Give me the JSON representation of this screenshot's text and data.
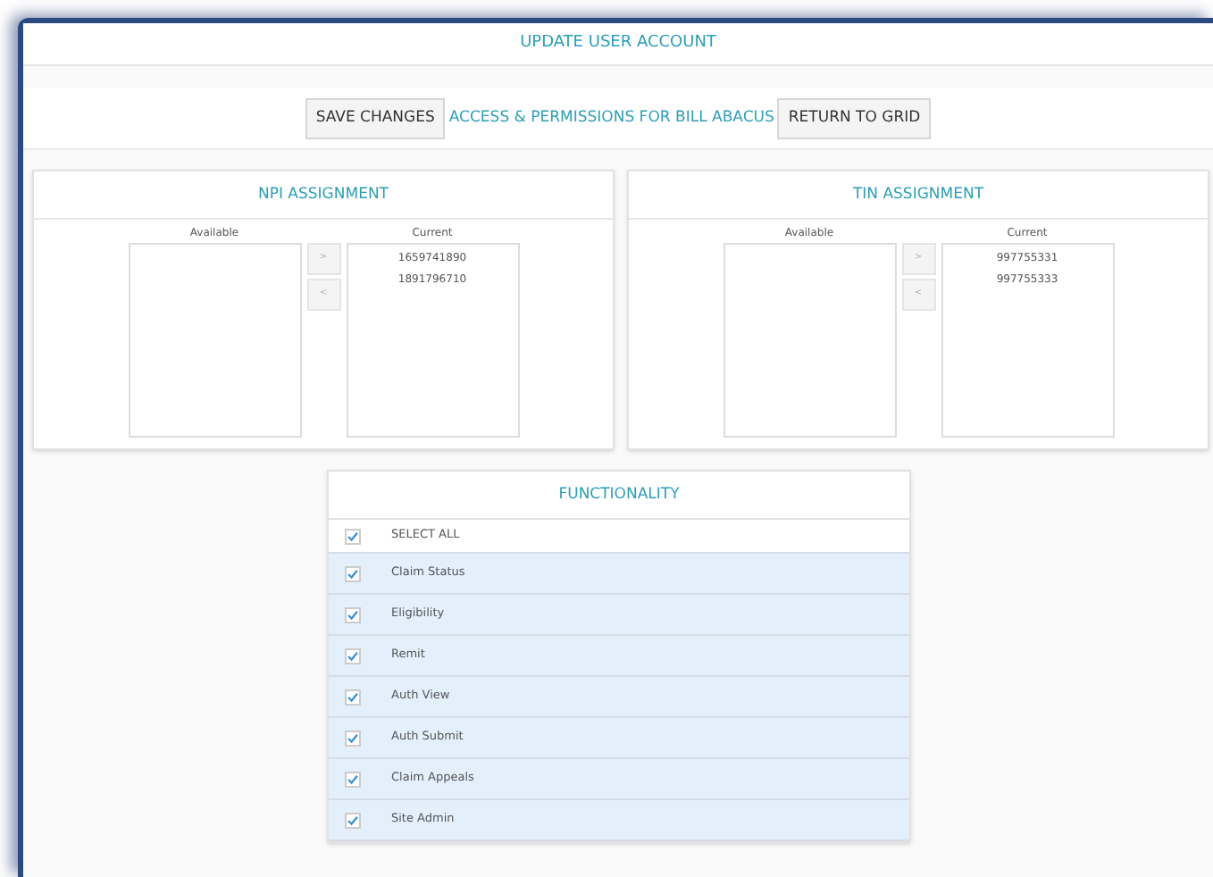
{
  "window": {
    "title": "UPDATE USER ACCOUNT"
  },
  "toolbar": {
    "save_button": "SAVE CHANGES",
    "heading": "ACCESS & PERMISSIONS FOR BILL ABACUS",
    "return_button": "RETURN TO GRID"
  },
  "assignments": [
    {
      "title": "NPI ASSIGNMENT",
      "available_label": "Available",
      "current_label": "Current",
      "add_button": ">",
      "remove_button": "<",
      "current": [
        "1659741890",
        "1891796710"
      ]
    },
    {
      "title": "TIN ASSIGNMENT",
      "available_label": "Available",
      "current_label": "Current",
      "add_button": ">",
      "remove_button": "<",
      "current": [
        "997755331",
        "997755333"
      ]
    }
  ],
  "functionality": {
    "title": "FUNCTIONALITY",
    "items": [
      {
        "kind": "select_all",
        "label": "SELECT ALL",
        "checked": true
      },
      {
        "kind": "option",
        "label": "Claim Status",
        "checked": true
      },
      {
        "kind": "option",
        "label": "Eligibility",
        "checked": true
      },
      {
        "kind": "option",
        "label": "Remit",
        "checked": true
      },
      {
        "kind": "option",
        "label": "Auth View",
        "checked": true
      },
      {
        "kind": "option",
        "label": "Auth Submit",
        "checked": true
      },
      {
        "kind": "option",
        "label": "Claim Appeals",
        "checked": true
      },
      {
        "kind": "option",
        "label": "Site Admin",
        "checked": true
      }
    ]
  }
}
